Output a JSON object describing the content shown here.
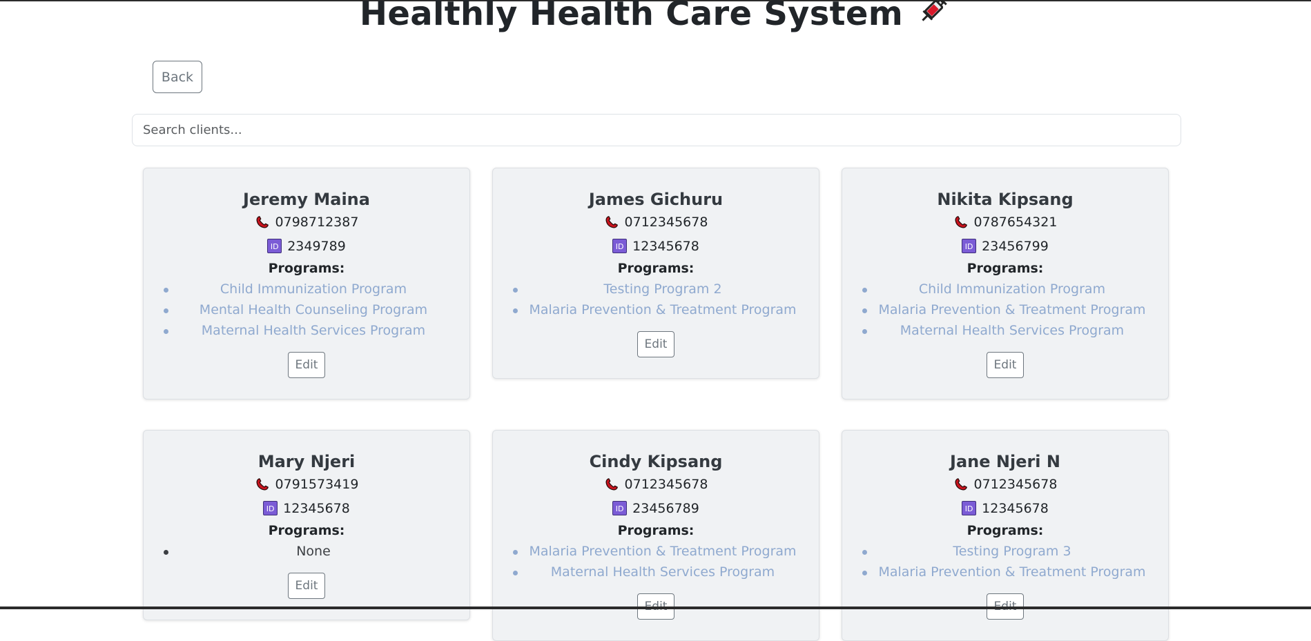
{
  "header": {
    "title": "Healthly Health Care System",
    "title_icon": "syringe-icon"
  },
  "actions": {
    "back_label": "Back"
  },
  "search": {
    "placeholder": "Search clients...",
    "value": ""
  },
  "labels": {
    "programs": "Programs:",
    "edit": "Edit"
  },
  "icons": {
    "phone": "telephone-receiver-icon",
    "id": "id-badge-icon"
  },
  "colors": {
    "program_link": "#8fa9cf",
    "card_bg": "#f0f2f4",
    "id_badge": "#7b5cd6",
    "phone_icon": "#c9141e"
  },
  "clients": [
    {
      "name": "Jeremy Maina",
      "phone": "0798712387",
      "id": "2349789",
      "programs": [
        "Child Immunization Program",
        "Mental Health Counseling Program",
        "Maternal Health Services Program"
      ]
    },
    {
      "name": "James Gichuru",
      "phone": "0712345678",
      "id": "12345678",
      "programs": [
        "Testing Program 2",
        "Malaria Prevention & Treatment Program"
      ]
    },
    {
      "name": "Nikita Kipsang",
      "phone": "0787654321",
      "id": "23456799",
      "programs": [
        "Child Immunization Program",
        "Malaria Prevention & Treatment Program",
        "Maternal Health Services Program"
      ]
    },
    {
      "name": "Mary Njeri",
      "phone": "0791573419",
      "id": "12345678",
      "programs": [
        "None"
      ]
    },
    {
      "name": "Cindy Kipsang",
      "phone": "0712345678",
      "id": "23456789",
      "programs": [
        "Malaria Prevention & Treatment Program",
        "Maternal Health Services Program"
      ]
    },
    {
      "name": "Jane Njeri N",
      "phone": "0712345678",
      "id": "12345678",
      "programs": [
        "Testing Program 3",
        "Malaria Prevention & Treatment Program"
      ]
    }
  ]
}
